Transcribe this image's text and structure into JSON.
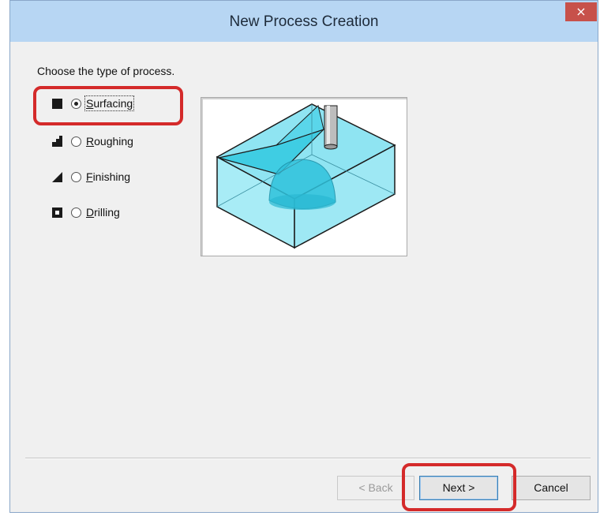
{
  "window": {
    "title": "New Process Creation",
    "close_glyph": "×"
  },
  "prompt": "Choose the type of process.",
  "options": [
    {
      "label_mnemonic": "S",
      "label_rest": "urfacing",
      "icon": "square-filled-icon",
      "selected": true
    },
    {
      "label_mnemonic": "R",
      "label_rest": "oughing",
      "icon": "steps-icon",
      "selected": false
    },
    {
      "label_mnemonic": "F",
      "label_rest": "inishing",
      "icon": "slope-icon",
      "selected": false
    },
    {
      "label_mnemonic": "D",
      "label_rest": "rilling",
      "icon": "hole-icon",
      "selected": false
    }
  ],
  "preview": {
    "icon": "surfacing-illustration"
  },
  "buttons": {
    "back": "< Back",
    "back_mnemonic": "B",
    "next": "Next >",
    "next_mnemonic": "N",
    "cancel": "Cancel"
  },
  "colors": {
    "titlebar": "#b7d6f3",
    "close": "#c7514a",
    "highlight": "#d42a2a",
    "block_fill": "#80e2f2"
  }
}
